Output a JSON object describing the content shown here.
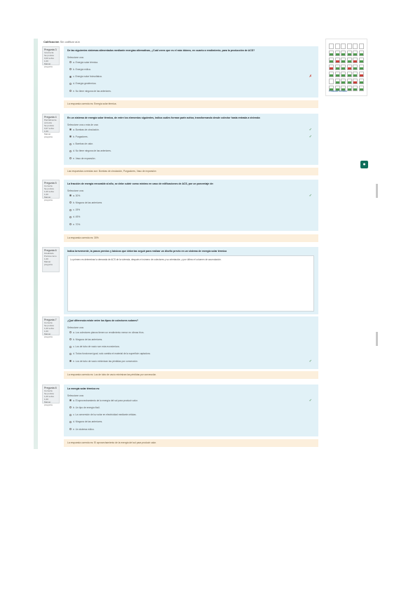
{
  "header": {
    "calificacion_label": "Calificación",
    "calificacion_value": "Sin calificar aún"
  },
  "nav": {
    "finish_label": "Finalizar revisión",
    "cells": [
      "none",
      "none",
      "none",
      "none",
      "none",
      "none",
      "correct",
      "correct",
      "correct",
      "correct",
      "correct",
      "correct",
      "correct",
      "incorrect",
      "correct",
      "correct",
      "incorrect",
      "correct",
      "incorrect",
      "correct",
      "correct",
      "incorrect",
      "correct",
      "correct",
      "correct",
      "correct",
      "correct",
      "correct",
      "correct",
      "incorrect",
      "none",
      "correct",
      "correct",
      "correct",
      "incorrect",
      "correct",
      "correct",
      "correct",
      "correct",
      "correct",
      "correct",
      "correct"
    ],
    "colors": {
      "correct": "#4f9a4f",
      "incorrect": "#c9413a",
      "none": "#ffffff"
    }
  },
  "fab_icon": "chat-icon",
  "questions": [
    {
      "info": [
        "Pregunta 3",
        "Incorrecta",
        "Se puntúa 0,00 sobre 1,00",
        "Marcar pregunta"
      ],
      "text": "De las siguientes sistemas alimentados mediante energías alternativas, ¿Cuál crees que es el más idóneo, en cuanto a rendimiento, para la producción de ACS?",
      "prompt": "Seleccione una:",
      "options": [
        {
          "label": "a. Energía solar térmica.",
          "selected": false,
          "mark": ""
        },
        {
          "label": "b. Energía eólica.",
          "selected": false,
          "mark": ""
        },
        {
          "label": "c. Energía solar fotovoltaica.",
          "selected": true,
          "mark": "✗"
        },
        {
          "label": "d. Energía geotérmica.",
          "selected": false,
          "mark": ""
        },
        {
          "label": "e. No tiene ninguna de las anteriores.",
          "selected": false,
          "mark": ""
        }
      ],
      "feedback": "La respuesta correcta es: Energía solar térmica."
    },
    {
      "info": [
        "Pregunta 4",
        "Parcialmente correcta",
        "Se puntúa 0,67 sobre 1,00",
        "Marcar pregunta"
      ],
      "text": "En un sistema de energía solar térmica, de entre los elementos siguientes, indica cuáles forman parte activa, transformando desde colector hasta entrada a vivienda:",
      "prompt": "Seleccione una o más de una:",
      "options": [
        {
          "label": "a. Bombas de circulación.",
          "selected": true,
          "mark": "✓"
        },
        {
          "label": "b. Purgadores.",
          "selected": true,
          "mark": "✓"
        },
        {
          "label": "c. Bombas de calor.",
          "selected": false,
          "mark": ""
        },
        {
          "label": "d. No tiene ninguna de las anteriores.",
          "selected": false,
          "mark": ""
        },
        {
          "label": "e. Vaso de expansión.",
          "selected": false,
          "mark": ""
        }
      ],
      "feedback": "Las respuestas correctas son: Bombas de circulación, Purgadores, Vaso de expansión"
    },
    {
      "info": [
        "Pregunta 5",
        "Correcta",
        "Se puntúa 1,00 sobre 1,00",
        "Marcar pregunta"
      ],
      "text": "La fracción de energía renovable al año, se debe cubrir como mínimo en caso de edificaciones de ACS, por un porcentaje de:",
      "prompt": "Seleccione una:",
      "options": [
        {
          "label": "a. 30%",
          "selected": true,
          "mark": "✓"
        },
        {
          "label": "b. Ninguna de las anteriores",
          "selected": false,
          "mark": ""
        },
        {
          "label": "c. 15%",
          "selected": false,
          "mark": ""
        },
        {
          "label": "d. 45%",
          "selected": false,
          "mark": ""
        },
        {
          "label": "e. 70%",
          "selected": false,
          "mark": ""
        }
      ],
      "feedback": "La respuesta correcta es: 30%"
    },
    {
      "info": [
        "Pregunta 6",
        "Finalizado",
        "Puntúa como 1,00",
        "Marcar pregunta"
      ],
      "text": "Indica brevemente, la pasos previos y básicos que deberías seguir para realizar un diseño previo en un sistema de energía solar térmica",
      "answer": "Lo primero es determinar la demanda de ACS de la vivienda, después el número de colectores y su orientación, y por último el volumen de acumulación."
    },
    {
      "info": [
        "Pregunta 7",
        "Correcta",
        "Se puntúa 1,00 sobre 1,00",
        "Marcar pregunta"
      ],
      "text": "¿Qué diferencia existe entre los tipos de colectores solares?",
      "prompt": "Seleccione una:",
      "options": [
        {
          "label": "a. Los colectores planos tienen un rendimiento menor en climas fríos.",
          "selected": false,
          "mark": ""
        },
        {
          "label": "b. Ninguna de las anteriores.",
          "selected": false,
          "mark": ""
        },
        {
          "label": "c. Los de tubo de vacío son más económicos.",
          "selected": false,
          "mark": ""
        },
        {
          "label": "d. Todos funcionan igual, solo cambia el material de la superficie captadora.",
          "selected": false,
          "mark": ""
        },
        {
          "label": "e. Los de tubo de vacío minimizan las pérdidas por convección.",
          "selected": true,
          "mark": "✓"
        }
      ],
      "feedback": "La respuesta correcta es: Los de tubo de vacío minimizan las pérdidas por convección."
    },
    {
      "info": [
        "Pregunta 8",
        "Correcta",
        "Se puntúa 1,00 sobre 1,00",
        "Marcar pregunta"
      ],
      "text": "La energía solar térmica es:",
      "prompt": "Seleccione una:",
      "options": [
        {
          "label": "a. El aprovechamiento de la energía del sol para producir calor.",
          "selected": true,
          "mark": "✓"
        },
        {
          "label": "b. Un tipo de energía fósil.",
          "selected": false,
          "mark": ""
        },
        {
          "label": "c. La conversión de luz solar en electricidad mediante células.",
          "selected": false,
          "mark": ""
        },
        {
          "label": "d. Ninguna de las anteriores.",
          "selected": false,
          "mark": ""
        },
        {
          "label": "e. Un sistema eólico.",
          "selected": false,
          "mark": ""
        }
      ],
      "feedback": "La respuesta correcta es: El aprovechamiento de la energía del sol para producir calor."
    }
  ]
}
